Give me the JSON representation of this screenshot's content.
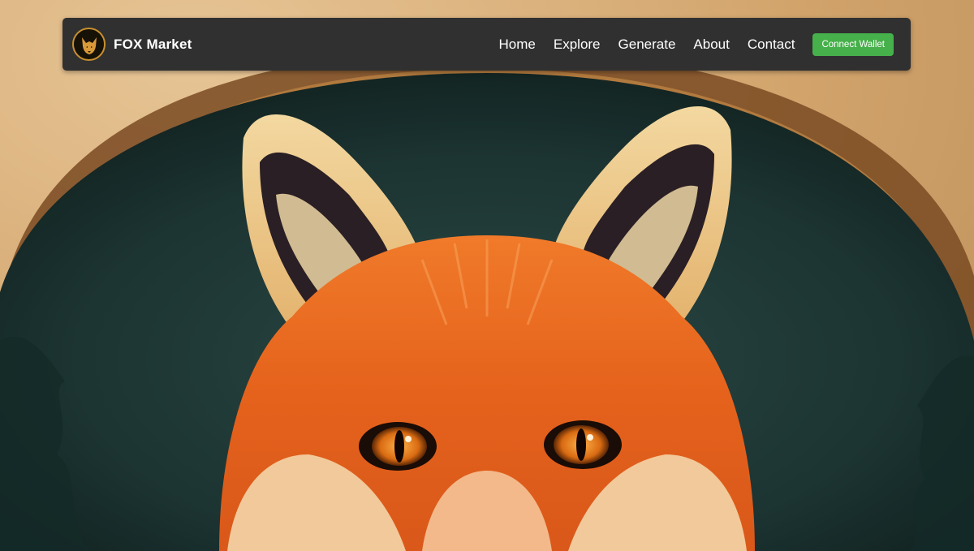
{
  "brand": {
    "name": "FOX Market",
    "logo_icon": "fox-logo-icon"
  },
  "nav": {
    "links": [
      {
        "label": "Home"
      },
      {
        "label": "Explore"
      },
      {
        "label": "Generate"
      },
      {
        "label": "About"
      },
      {
        "label": "Contact"
      }
    ],
    "connect_label": "Connect Wallet"
  },
  "hero": {
    "image": "fox-portrait-hero"
  },
  "colors": {
    "navbar_bg": "#303030",
    "accent_green": "#46b04a",
    "logo_gold": "#c8902f",
    "parchment": "#d9b27e",
    "backdrop_teal": "#1f3535",
    "fox_orange": "#e56a22"
  }
}
